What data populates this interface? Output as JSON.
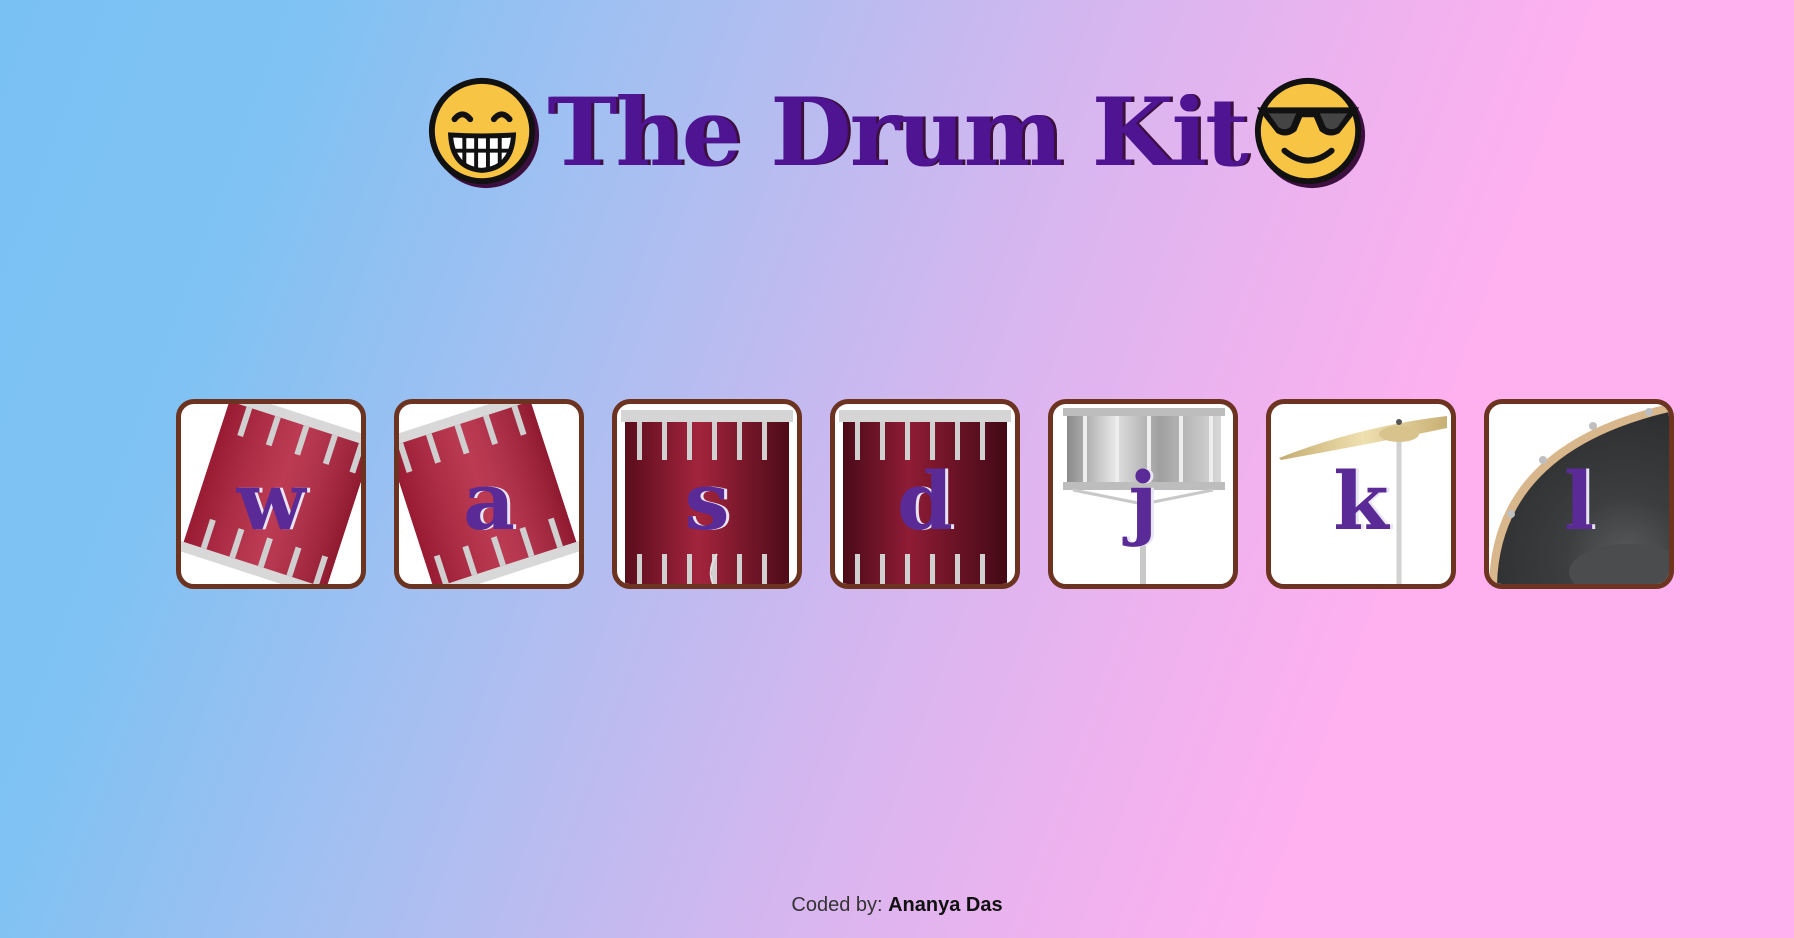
{
  "header": {
    "title": "The Drum Kit",
    "left_emoji": "grinning-face-icon",
    "right_emoji": "sunglasses-face-icon"
  },
  "drums": [
    {
      "key": "w",
      "art": "tom-red-tilted-right"
    },
    {
      "key": "a",
      "art": "tom-red-tilted-left"
    },
    {
      "key": "s",
      "art": "bass-drum-red"
    },
    {
      "key": "d",
      "art": "bass-drum-dark-red"
    },
    {
      "key": "j",
      "art": "snare-silver"
    },
    {
      "key": "k",
      "art": "crash-cymbal"
    },
    {
      "key": "l",
      "art": "kick-drum-black"
    }
  ],
  "footer": {
    "prefix": "Coded by:",
    "author": "Ananya Das"
  },
  "colors": {
    "title": "#4e1491",
    "drum_border": "#6b3320",
    "key_letter": "#5a2b96",
    "gradient_left": "#7ac1f3",
    "gradient_right": "#ffb1ef"
  }
}
